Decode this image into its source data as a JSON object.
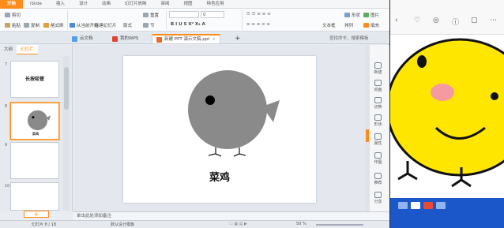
{
  "ribbon_tabs": [
    "开始",
    "iSlide",
    "插入",
    "设计",
    "动画",
    "幻灯片放映",
    "审阅",
    "视图",
    "特色应用"
  ],
  "ribbon": {
    "cut": "剪切",
    "copy": "复制",
    "paste": "粘贴",
    "format_painter": "格式刷",
    "from_current": "从当前开始",
    "new_slide": "新建幻灯片",
    "layout": "版式",
    "reset": "重置",
    "section": "节",
    "font_size": "0",
    "textbox": "文本框",
    "shape": "形状",
    "picture": "图片",
    "arrange": "排列",
    "fill": "填充"
  },
  "doc_tabs": {
    "t1": "云文档",
    "t2": "我的WPS",
    "t3": "新建 PPT 演示文稿.ppt",
    "close": "×",
    "add": "+"
  },
  "search": {
    "cmd": "查找命令、搜索模板"
  },
  "left_panel": {
    "tabs": [
      "大纲",
      "幻灯片"
    ],
    "thumbs": [
      {
        "num": "7",
        "title": "长按吸管"
      },
      {
        "num": "8",
        "title": "菜鸡"
      },
      {
        "num": "9",
        "title": ""
      },
      {
        "num": "10",
        "title": ""
      }
    ],
    "add": "+"
  },
  "slide": {
    "caption": "菜鸡"
  },
  "notes": {
    "placeholder": "单击此处添加备注"
  },
  "right_sidebar": [
    "新建",
    "动画",
    "切换",
    "形状",
    "属性",
    "作图",
    "推荐",
    "分享"
  ],
  "status": {
    "slide_info": "幻灯片 8 / 18",
    "template": "默认设计模板",
    "zoom": "50 %"
  },
  "colors": {
    "accent": "#ff8c1a",
    "bird_body": "#8a8a8a",
    "chick_yellow": "#ffe600",
    "taskbar": "#1b57c8"
  }
}
